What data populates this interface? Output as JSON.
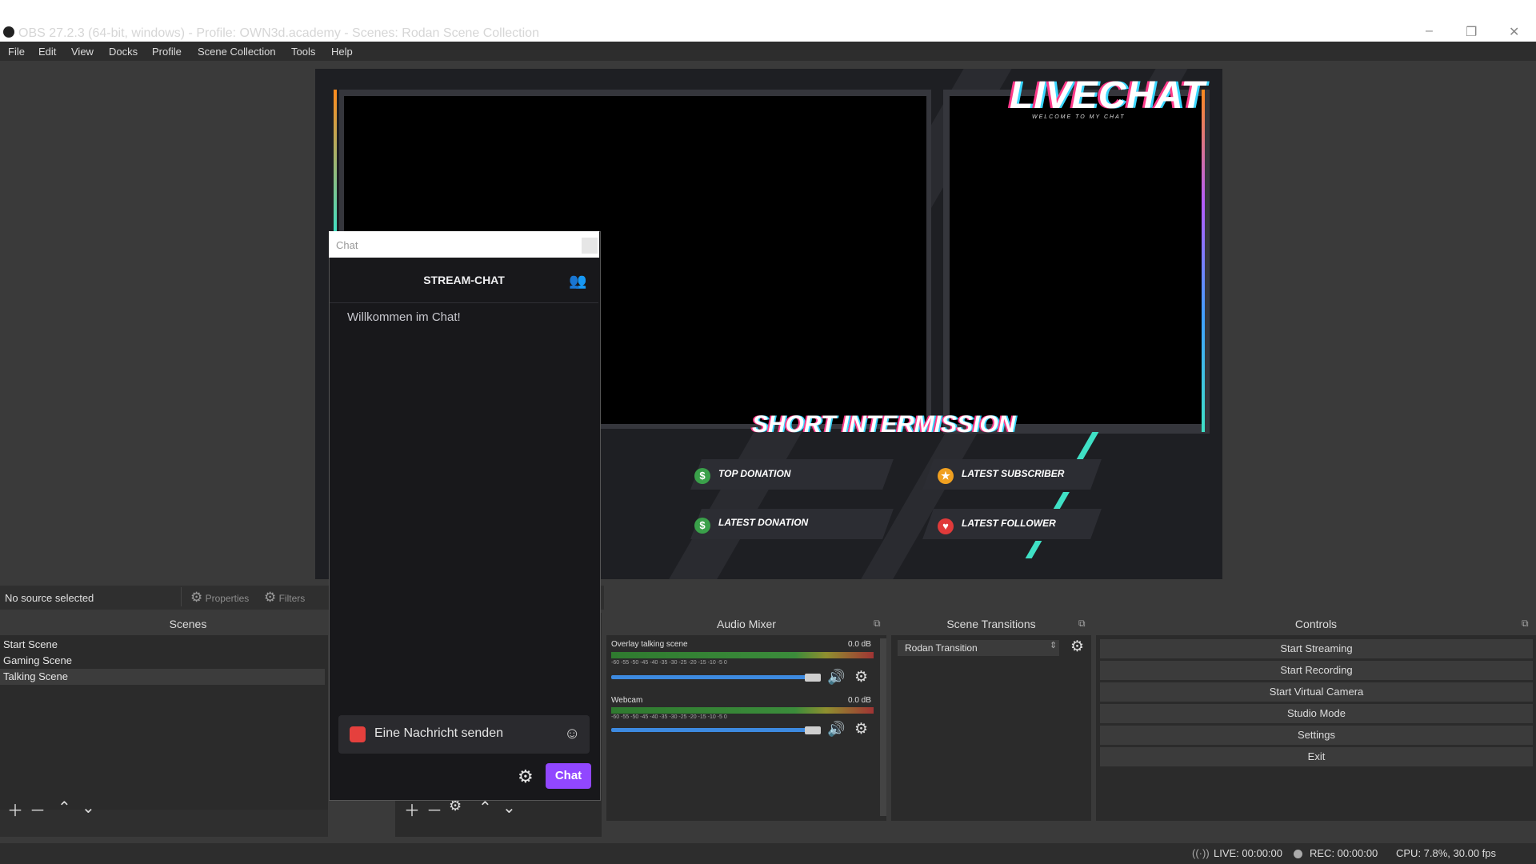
{
  "window": {
    "title": "OBS 27.2.3 (64-bit, windows) - Profile: OWN3d.academy - Scenes: Rodan Scene Collection",
    "minimize": "–",
    "maximize": "❐",
    "close": "✕"
  },
  "menu": [
    "File",
    "Edit",
    "View",
    "Docks",
    "Profile",
    "Scene Collection",
    "Tools",
    "Help"
  ],
  "preview": {
    "logo": "LIVECHAT",
    "logo_sub": "WELCOME TO MY CHAT",
    "intermission": "SHORT INTERMISSION",
    "stats": {
      "top_donation": "TOP DONATION",
      "latest_donation": "LATEST DONATION",
      "latest_subscriber": "LATEST SUBSCRIBER",
      "latest_follower": "LATEST FOLLOWER"
    }
  },
  "source_bar": {
    "status": "No source selected",
    "properties": "Properties",
    "filters": "Filters"
  },
  "scenes": {
    "title": "Scenes",
    "items": [
      "Start Scene",
      "Gaming Scene",
      "Talking Scene"
    ],
    "selected": "Talking Scene"
  },
  "chat": {
    "address": "Chat",
    "title": "STREAM-CHAT",
    "welcome": "Willkommen im Chat!",
    "placeholder": "Eine Nachricht senden",
    "send": "Chat"
  },
  "audio_mixer": {
    "title": "Audio Mixer",
    "channels": [
      {
        "name": "Overlay talking scene",
        "level": "0.0 dB",
        "volume": 1.0
      },
      {
        "name": "Webcam",
        "level": "0.0 dB",
        "volume": 1.0
      }
    ],
    "ticks": "-60  -55  -50  -45  -40  -35  -30  -25  -20  -15  -10  -5   0"
  },
  "scene_transitions": {
    "title": "Scene Transitions",
    "selected": "Rodan Transition"
  },
  "controls": {
    "title": "Controls",
    "buttons": [
      "Start Streaming",
      "Start Recording",
      "Start Virtual Camera",
      "Studio Mode",
      "Settings",
      "Exit"
    ]
  },
  "status": {
    "live": "LIVE: 00:00:00",
    "rec": "REC: 00:00:00",
    "cpu": "CPU: 7.8%, 30.00 fps"
  },
  "colors": {
    "accent_purple": "#9147ff",
    "neon_teal": "#3fe0c5",
    "slider_blue": "#3d8ae0"
  }
}
